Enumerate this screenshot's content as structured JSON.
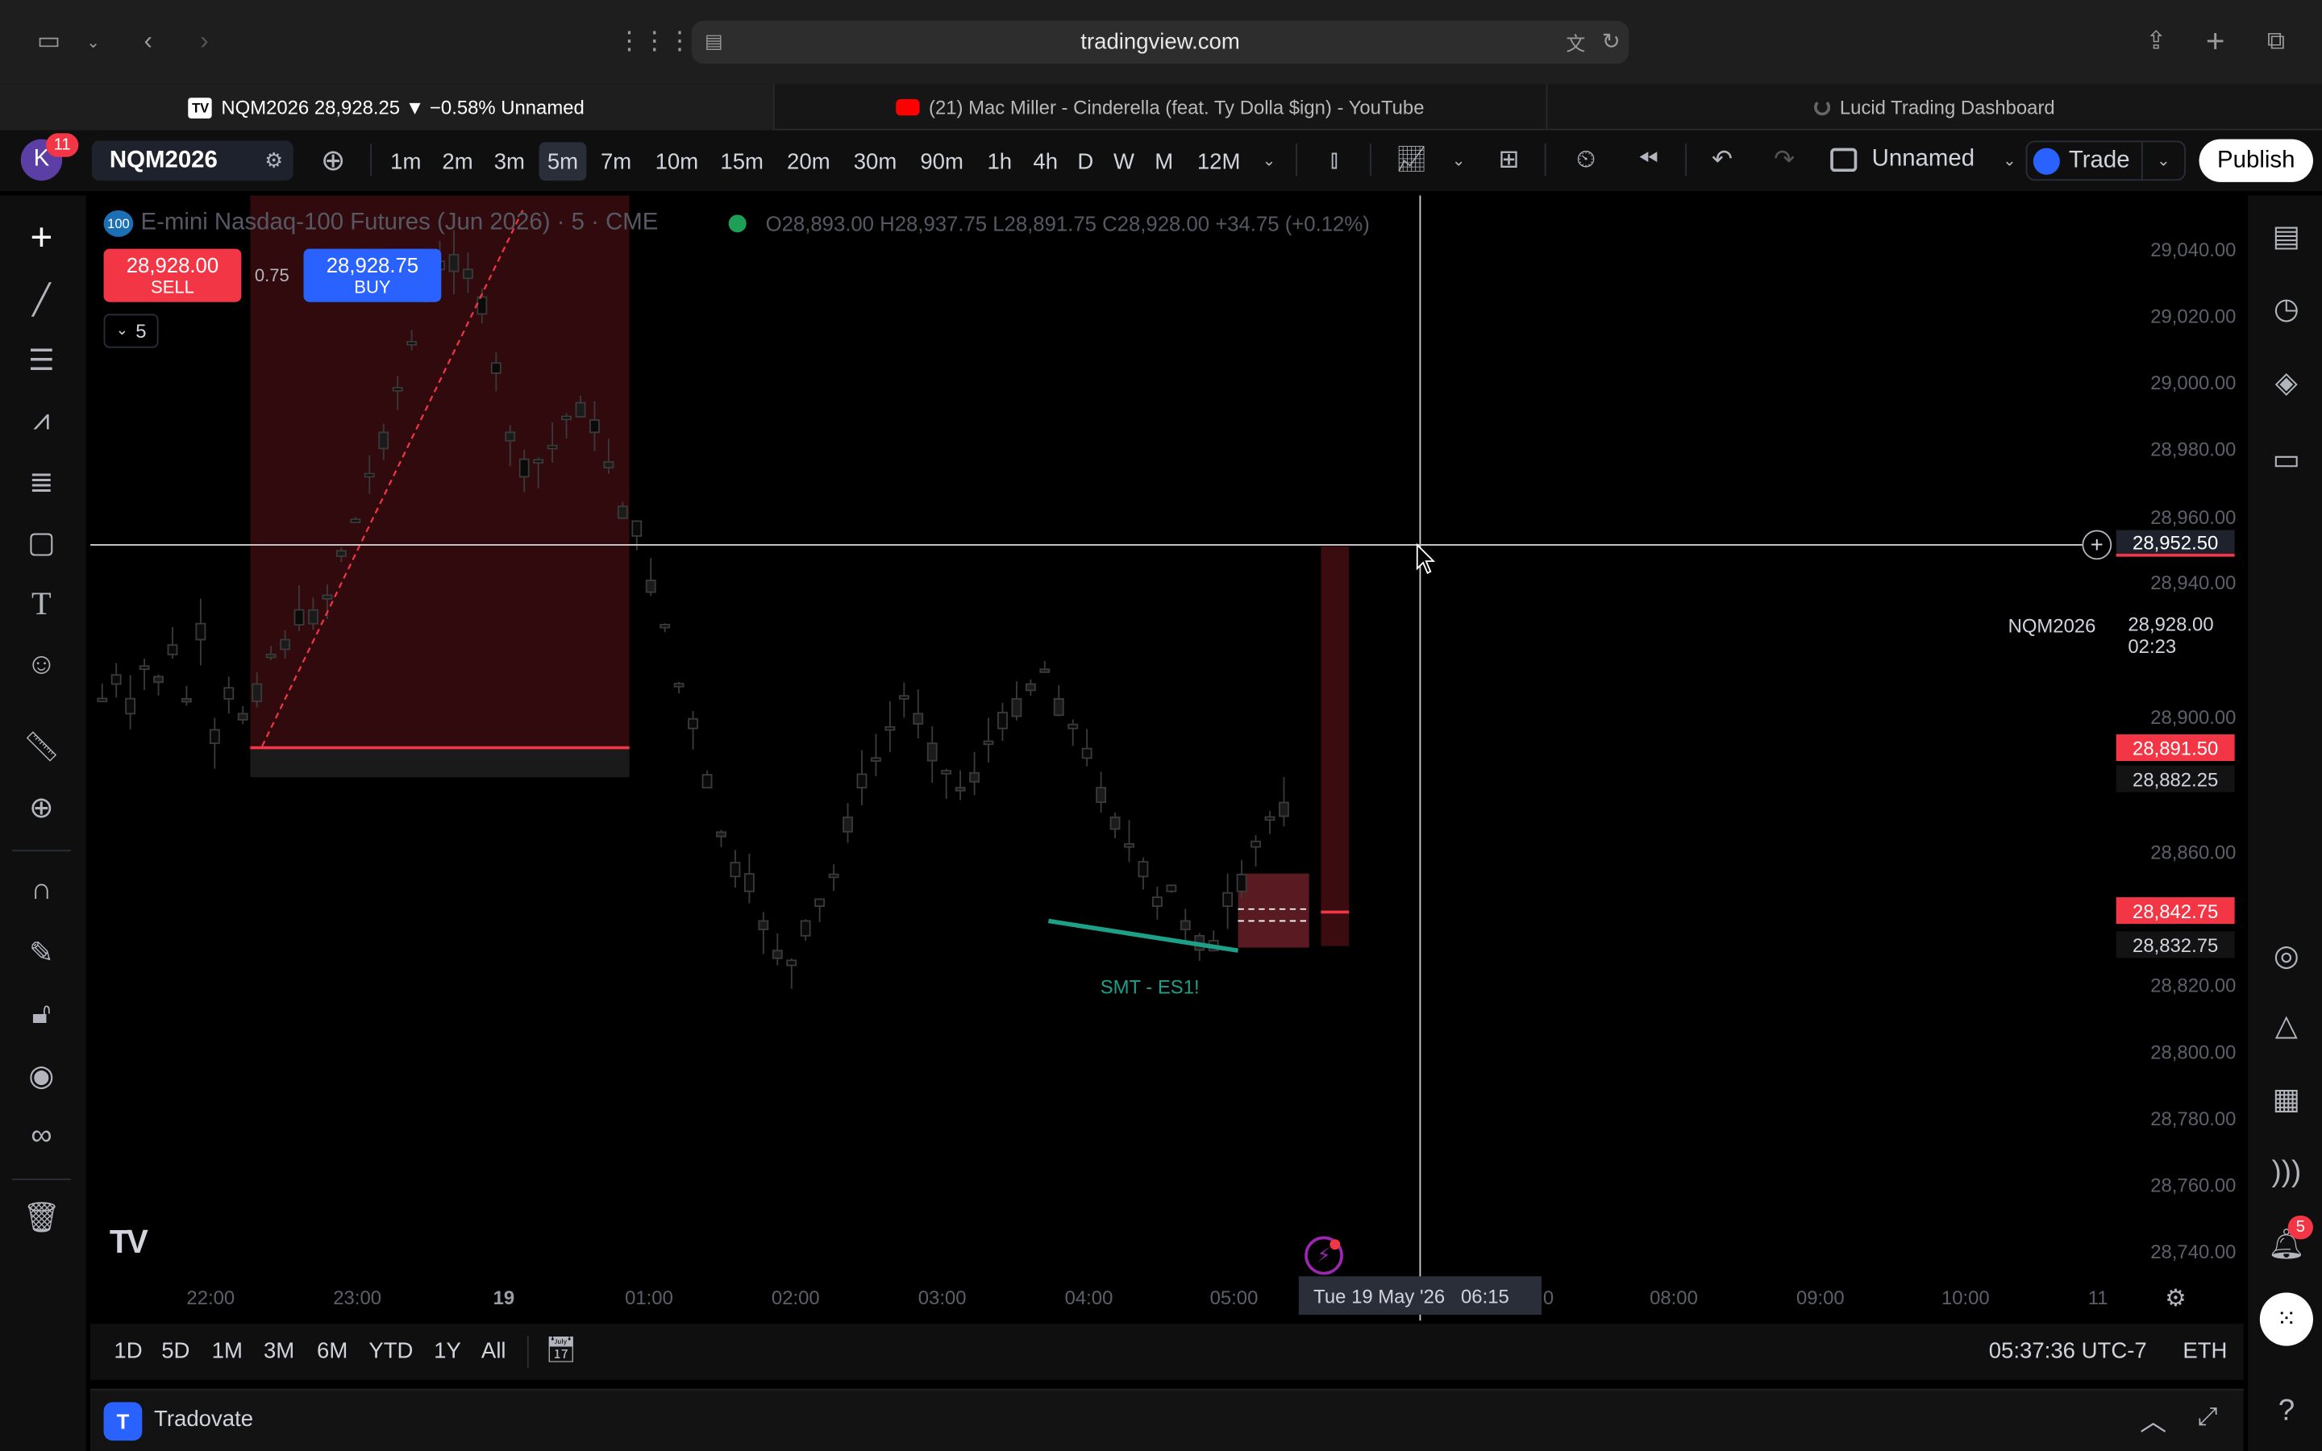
{
  "browser": {
    "url": "tradingview.com",
    "tabs": [
      {
        "label": "NQM2026 28,928.25 ▼ −0.58% Unnamed"
      },
      {
        "label": "(21) Mac Miller - Cinderella (feat. Ty Dolla $ign) - YouTube"
      },
      {
        "label": "Lucid Trading Dashboard"
      }
    ]
  },
  "toolbar": {
    "avatar_letter": "K",
    "avatar_badge": "11",
    "symbol": "NQM2026",
    "timeframes": [
      "1m",
      "2m",
      "3m",
      "5m",
      "7m",
      "10m",
      "15m",
      "20m",
      "30m",
      "90m",
      "1h",
      "4h",
      "D",
      "W",
      "M",
      "12M"
    ],
    "selected_timeframe": "5m",
    "layout_name": "Unnamed",
    "trade_label": "Trade",
    "publish_label": "Publish"
  },
  "legend": {
    "title": "E-mini Nasdaq-100 Futures (Jun 2026) · 5 · CME",
    "ohlc": "O28,893.00 H28,937.75 L28,891.75 C28,928.00 +34.75 (+0.12%)",
    "badge": "100",
    "sell_price": "28,928.00",
    "sell_label": "SELL",
    "spread": "0.75",
    "buy_price": "28,928.75",
    "buy_label": "BUY",
    "indicators_count": "5"
  },
  "price_axis": {
    "ticks": [
      "29,040.00",
      "29,020.00",
      "29,000.00",
      "28,980.00",
      "28,960.00",
      "28,940.00",
      "28,900.00",
      "28,860.00",
      "28,820.00",
      "28,800.00",
      "28,780.00",
      "28,760.00",
      "28,740.00"
    ],
    "crosshair_price": "28,952.50",
    "symbol_label": "NQM2026",
    "last_price": "28,928.00",
    "countdown": "02:23",
    "tag1": "28,891.50",
    "tag2": "28,882.25",
    "tag3": "28,842.75",
    "tag4": "28,832.75"
  },
  "time_axis": {
    "ticks": [
      "22:00",
      "23:00",
      "19",
      "01:00",
      "02:00",
      "03:00",
      "04:00",
      "05:00",
      "08:00",
      "09:00",
      "10:00",
      "11"
    ],
    "crosshair_time": "Tue 19 May '26   06:15",
    "crosshair_tail": "0"
  },
  "annotation": {
    "smt_label": "SMT - ES1!"
  },
  "colors": {
    "up": "#cfcfcf",
    "down": "#3a3a3a",
    "red": "#f23645",
    "teal": "#1e9f88",
    "blue": "#2962ff"
  },
  "bottom": {
    "ranges": [
      "1D",
      "5D",
      "1M",
      "3M",
      "6M",
      "YTD",
      "1Y",
      "All"
    ],
    "clock": "05:37:36 UTC-7",
    "session": "ETH",
    "broker": "Tradovate"
  },
  "right_panel": {
    "notifications_badge": "5"
  }
}
